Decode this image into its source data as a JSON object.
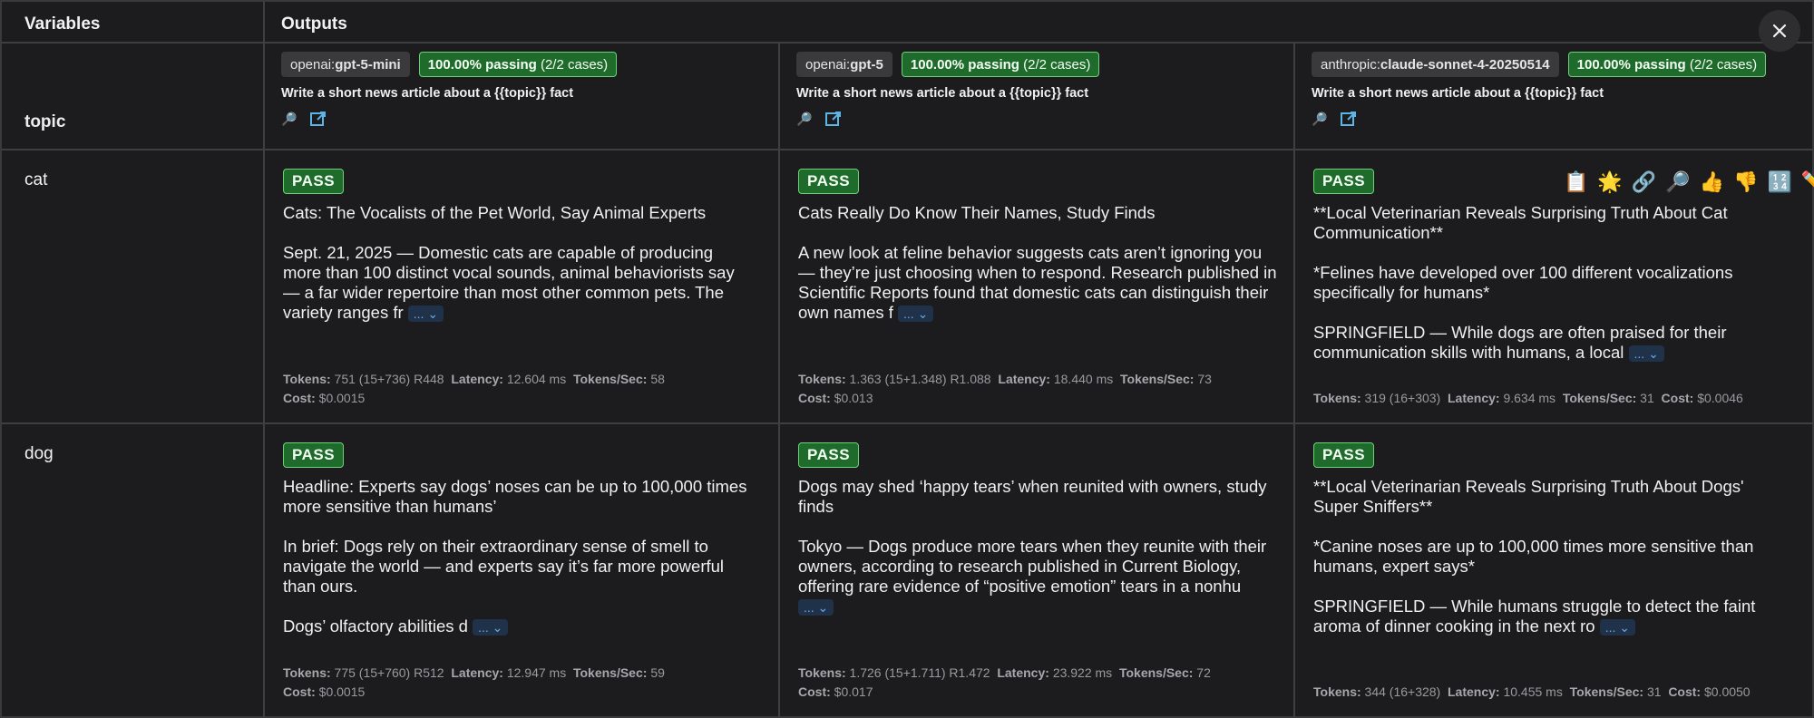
{
  "header": {
    "variables": "Variables",
    "outputs": "Outputs",
    "topic": "topic"
  },
  "columns": [
    {
      "provider": "openai:",
      "model": "gpt-5-mini",
      "passing_pct": "100.00% passing",
      "passing_cases": "(2/2 cases)",
      "prompt": "Write a short news article about a {{topic}} fact"
    },
    {
      "provider": "openai:",
      "model": "gpt-5",
      "passing_pct": "100.00% passing",
      "passing_cases": "(2/2 cases)",
      "prompt": "Write a short news article about a {{topic}} fact"
    },
    {
      "provider": "anthropic:",
      "model": "claude-sonnet-4-20250514",
      "passing_pct": "100.00% passing",
      "passing_cases": "(2/2 cases)",
      "prompt": "Write a short news article about a {{topic}} fact"
    }
  ],
  "rows": [
    {
      "var": "cat",
      "cells": [
        {
          "badge": "PASS",
          "text": "Cats: The Vocalists of the Pet World, Say Animal Experts\n\nSept. 21, 2025 — Domestic cats are capable of producing more than 100 distinct vocal sounds, animal behaviorists say — a far wider repertoire than most other common pets. The variety ranges fr",
          "more": "... ⌄",
          "tokens_label": "Tokens:",
          "tokens": "751 (15+736) R448",
          "latency_label": "Latency:",
          "latency": "12.604 ms",
          "tps_label": "Tokens/Sec:",
          "tps": "58",
          "cost_label": "Cost:",
          "cost": "$0.0015"
        },
        {
          "badge": "PASS",
          "text": "Cats Really Do Know Their Names, Study Finds\n\nA new look at feline behavior suggests cats aren’t ignoring you — they’re just choosing when to respond. Research published in Scientific Reports found that domestic cats can distinguish their own names f",
          "more": "... ⌄",
          "tokens_label": "Tokens:",
          "tokens": "1.363 (15+1.348) R1.088",
          "latency_label": "Latency:",
          "latency": "18.440 ms",
          "tps_label": "Tokens/Sec:",
          "tps": "73",
          "cost_label": "Cost:",
          "cost": "$0.013"
        },
        {
          "badge": "PASS",
          "text": "**Local Veterinarian Reveals Surprising Truth About Cat Communication**\n\n*Felines have developed over 100 different vocalizations specifically for humans*\n\nSPRINGFIELD — While dogs are often praised for their communication skills with humans, a local",
          "more": "... ⌄",
          "tokens_label": "Tokens:",
          "tokens": "319 (16+303)",
          "latency_label": "Latency:",
          "latency": "9.634 ms",
          "tps_label": "Tokens/Sec:",
          "tps": "31",
          "cost_label": "Cost:",
          "cost": "$0.0046"
        }
      ]
    },
    {
      "var": "dog",
      "cells": [
        {
          "badge": "PASS",
          "text": "Headline: Experts say dogs’ noses can be up to 100,000 times more sensitive than humans’\n\nIn brief: Dogs rely on their extraordinary sense of smell to navigate the world — and experts say it’s far more powerful than ours.\n\nDogs’ olfactory abilities d",
          "more": "... ⌄",
          "tokens_label": "Tokens:",
          "tokens": "775 (15+760) R512",
          "latency_label": "Latency:",
          "latency": "12.947 ms",
          "tps_label": "Tokens/Sec:",
          "tps": "59",
          "cost_label": "Cost:",
          "cost": "$0.0015"
        },
        {
          "badge": "PASS",
          "text": "Dogs may shed ‘happy tears’ when reunited with owners, study finds\n\nTokyo — Dogs produce more tears when they reunite with their owners, according to research published in Current Biology, offering rare evidence of “positive emotion” tears in a nonhu",
          "more": "... ⌄",
          "tokens_label": "Tokens:",
          "tokens": "1.726 (15+1.711) R1.472",
          "latency_label": "Latency:",
          "latency": "23.922 ms",
          "tps_label": "Tokens/Sec:",
          "tps": "72",
          "cost_label": "Cost:",
          "cost": "$0.017"
        },
        {
          "badge": "PASS",
          "text": "**Local Veterinarian Reveals Surprising Truth About Dogs' Super Sniffers**\n\n*Canine noses are up to 100,000 times more sensitive than humans, expert says*\n\nSPRINGFIELD — While humans struggle to detect the faint aroma of dinner cooking in the next ro",
          "more": "... ⌄",
          "tokens_label": "Tokens:",
          "tokens": "344 (16+328)",
          "latency_label": "Latency:",
          "latency": "10.455 ms",
          "tps_label": "Tokens/Sec:",
          "tps": "31",
          "cost_label": "Cost:",
          "cost": "$0.0050"
        }
      ]
    }
  ],
  "actions": [
    "📋",
    "🌟",
    "🔗",
    "🔎",
    "👍",
    "👎",
    "🔢",
    "✏️"
  ],
  "icons": {
    "search": "🔎",
    "external": "external-link-icon",
    "close": "close-icon"
  }
}
